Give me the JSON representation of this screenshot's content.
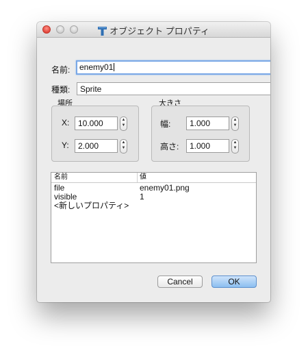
{
  "window": {
    "title": "オブジェクト プロパティ"
  },
  "form": {
    "name_label": "名前:",
    "name_value": "enemy01",
    "type_label": "種類:",
    "type_value": "Sprite"
  },
  "location": {
    "title": "場所",
    "x_label": "X:",
    "x_value": "10.000",
    "y_label": "Y:",
    "y_value": "2.000"
  },
  "size": {
    "title": "大きさ",
    "width_label": "幅:",
    "width_value": "1.000",
    "height_label": "高さ:",
    "height_value": "1.000"
  },
  "properties": {
    "columns": [
      "名前",
      "値"
    ],
    "rows": [
      {
        "name": "file",
        "value": "enemy01.png"
      },
      {
        "name": "visible",
        "value": "1"
      },
      {
        "name": "<新しいプロパティ>",
        "value": ""
      }
    ]
  },
  "buttons": {
    "cancel": "Cancel",
    "ok": "OK"
  },
  "colors": {
    "accent": "#7aa8e6",
    "ok_button": "#8bbef0",
    "close_button": "#e2463b"
  }
}
